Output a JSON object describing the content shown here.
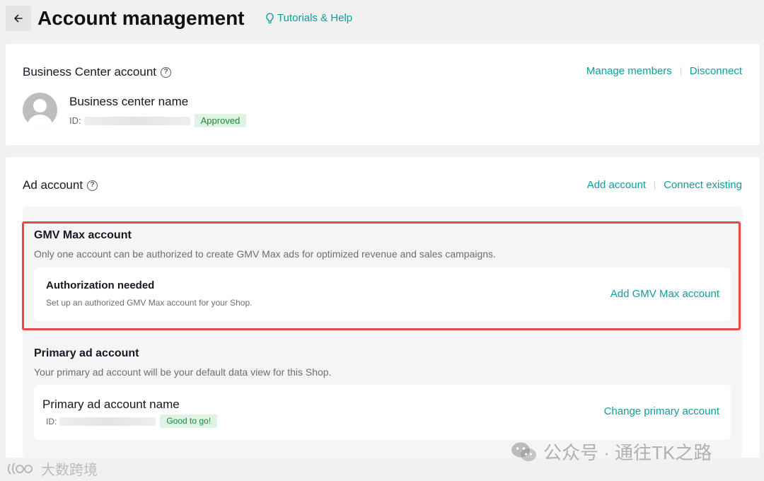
{
  "header": {
    "title": "Account management",
    "help_label": "Tutorials & Help"
  },
  "business_center": {
    "section_title": "Business Center account",
    "manage_members": "Manage members",
    "disconnect": "Disconnect",
    "name": "Business center name",
    "id_label": "ID:",
    "status": "Approved"
  },
  "ad_account": {
    "section_title": "Ad account",
    "add_account": "Add account",
    "connect_existing": "Connect existing",
    "gmv": {
      "title": "GMV Max account",
      "description": "Only one account can be authorized to create GMV Max ads for optimized revenue and sales campaigns.",
      "row_title": "Authorization needed",
      "row_desc": "Set up an authorized GMV Max account for your Shop.",
      "row_action": "Add GMV Max account"
    },
    "primary": {
      "title": "Primary ad account",
      "description": "Your primary ad account will be your default data view for this Shop.",
      "row_title": "Primary ad account name",
      "id_label": "ID:",
      "status": "Good to go!",
      "row_action": "Change primary account"
    }
  },
  "watermarks": {
    "right": "公众号 · 通往TK之路",
    "left": "大数跨境"
  },
  "colors": {
    "accent": "#0f9d99",
    "highlight_border": "#e5494a",
    "badge_bg": "#dff3e4",
    "badge_text": "#1a8a3a"
  }
}
